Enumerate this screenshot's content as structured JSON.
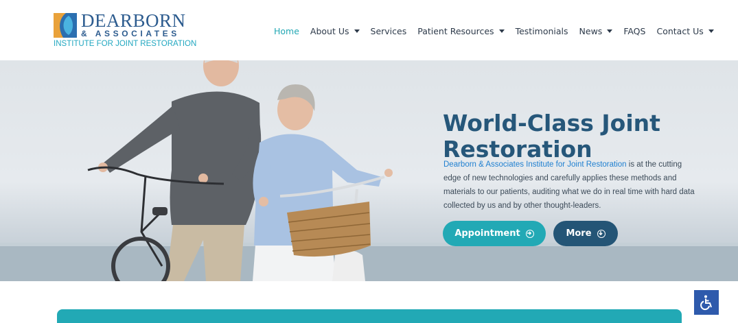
{
  "logo": {
    "name": "DEARBORN",
    "assoc": "& ASSOCIATES",
    "tagline": "INSTITUTE FOR JOINT RESTORATION",
    "icon": "logo-mark"
  },
  "nav": {
    "items": [
      {
        "label": "Home",
        "dropdown": false,
        "active": true
      },
      {
        "label": "About Us",
        "dropdown": true
      },
      {
        "label": "Services",
        "dropdown": false
      },
      {
        "label": "Patient Resources",
        "dropdown": true
      },
      {
        "label": "Testimonials",
        "dropdown": false
      },
      {
        "label": "News",
        "dropdown": true
      },
      {
        "label": "FAQS",
        "dropdown": false
      },
      {
        "label": "Contact Us",
        "dropdown": true
      }
    ]
  },
  "hero": {
    "title": "World-Class Joint Restoration",
    "text_link": "Dearborn & Associates Institute for Joint Restoration",
    "text_rest": " is at the cutting edge of new technologies and carefully applies these methods and materials to our patients, auditing what we do in real time with hard data collected by us and by other thought-leaders.",
    "appointment_label": "Appointment",
    "appointment_icon": "arrow-right-circle-icon",
    "more_label": "More",
    "more_icon": "arrow-down-circle-icon"
  },
  "accessibility": {
    "icon": "wheelchair-icon"
  },
  "colors": {
    "accent": "#22a9b5",
    "navy": "#245576",
    "title": "#26577a",
    "link": "#1e7fd0",
    "a11y": "#2e5aac"
  }
}
